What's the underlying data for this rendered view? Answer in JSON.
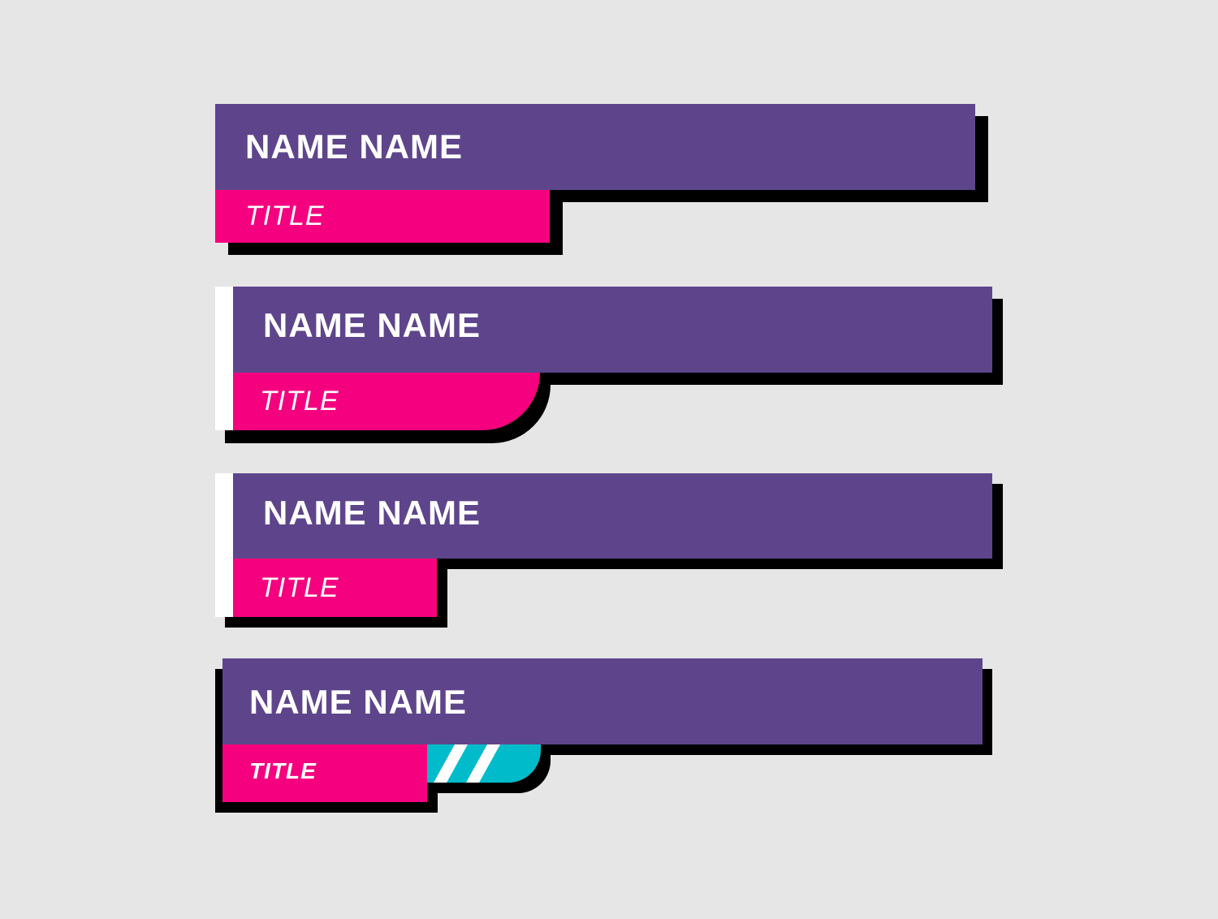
{
  "colors": {
    "background": "#e6e6e6",
    "name_bar": "#5e458b",
    "title_bar": "#f5007f",
    "shadow": "#000000",
    "accent_stripe": "#ffffff",
    "cyan": "#00bcca"
  },
  "lower_thirds": [
    {
      "name": "NAME NAME",
      "title": "TITLE",
      "style": "square"
    },
    {
      "name": "NAME NAME",
      "title": "TITLE",
      "style": "rounded-tab"
    },
    {
      "name": "NAME NAME",
      "title": "TITLE",
      "style": "short-tab"
    },
    {
      "name": "NAME NAME",
      "title": "TITLE",
      "style": "striped-tab"
    }
  ]
}
